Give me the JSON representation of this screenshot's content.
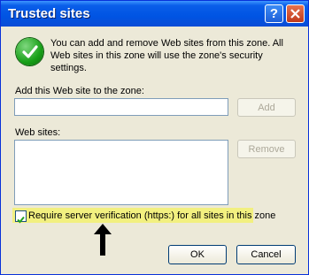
{
  "window": {
    "title": "Trusted sites",
    "help_label": "?",
    "close_label": "✕"
  },
  "info": {
    "icon": "checkmark-icon",
    "text": "You can add and remove Web sites from this zone. All Web sites in this zone will use the zone's security settings."
  },
  "add_site": {
    "label": "Add this Web site to the zone:",
    "value": "",
    "button_label": "Add"
  },
  "websites": {
    "label": "Web sites:",
    "items": [],
    "remove_label": "Remove"
  },
  "require_verification": {
    "label": "Require server verification (https:) for all sites in this zone",
    "checked": true
  },
  "footer": {
    "ok_label": "OK",
    "cancel_label": "Cancel"
  },
  "colors": {
    "titlebar": "#0054e3",
    "dialog_bg": "#ece9d8",
    "highlight": "#f2f080",
    "check_green": "#18a018"
  }
}
